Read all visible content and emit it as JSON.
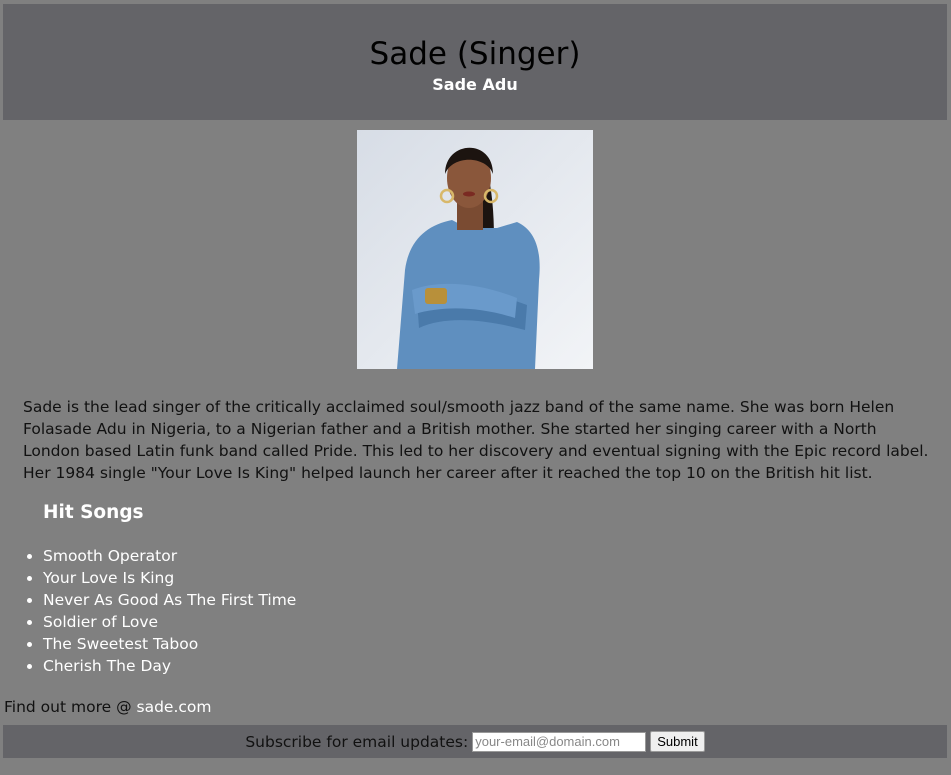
{
  "header": {
    "title": "Sade (Singer)",
    "subtitle": "Sade Adu"
  },
  "portrait": {
    "description_icon": "portrait-photo"
  },
  "bio": {
    "text": "Sade is the lead singer of the critically acclaimed soul/smooth jazz band of the same name. She was born Helen Folasade Adu in Nigeria, to a Nigerian father and a British mother. She started her singing career with a North London based Latin funk band called Pride. This led to her discovery and eventual signing with the Epic record label. Her 1984 single \"Your Love Is King\" helped launch her career after it reached the top 10 on the British hit list."
  },
  "hit_songs": {
    "heading": "Hit Songs",
    "items": [
      "Smooth Operator",
      "Your Love Is King",
      "Never As Good As The First Time",
      "Soldier of Love",
      "The Sweetest Taboo",
      "Cherish The Day"
    ]
  },
  "find_more": {
    "prefix": "Find out more @ ",
    "link_text": "sade.com"
  },
  "subscribe": {
    "label": "Subscribe for email updates:",
    "placeholder": "your-email@domain.com",
    "button_label": "Submit"
  }
}
